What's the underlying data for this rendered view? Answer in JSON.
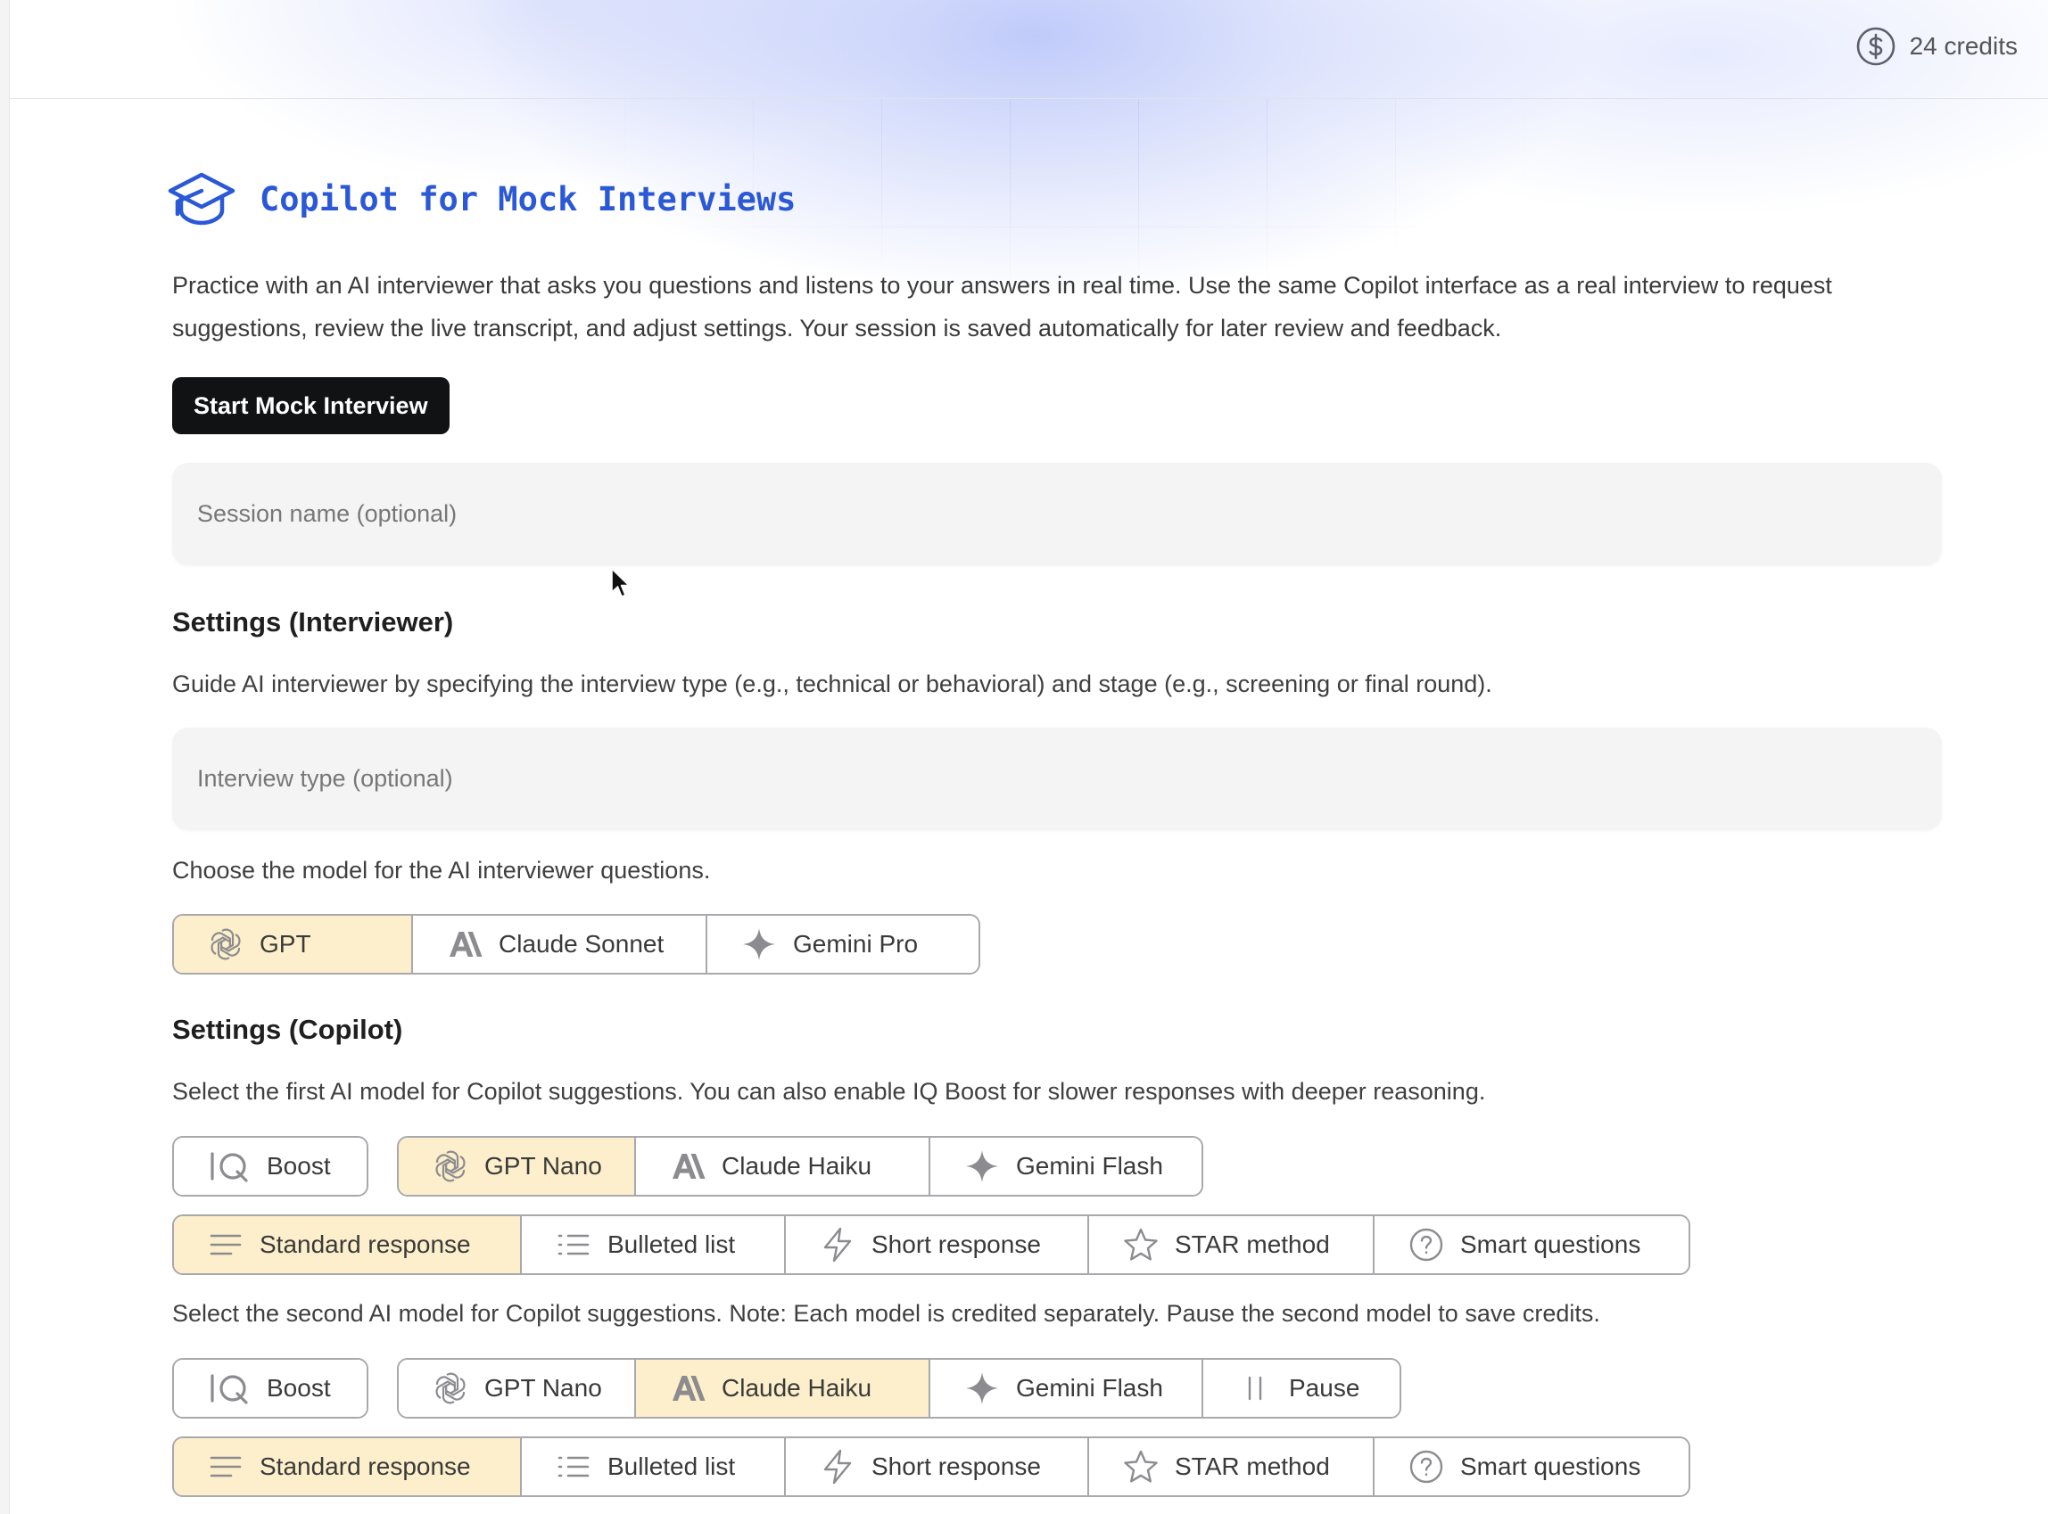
{
  "header": {
    "credits_label": "24 credits"
  },
  "page": {
    "title": "Copilot for Mock Interviews",
    "intro": "Practice with an AI interviewer that asks you questions and listens to your answers in real time. Use the same Copilot interface as a real interview to request suggestions, review the live transcript, and adjust settings. Your session is saved automatically for later review and feedback.",
    "start_button": "Start Mock Interview",
    "session_placeholder": "Session name (optional)"
  },
  "interviewer": {
    "heading": "Settings (Interviewer)",
    "desc": "Guide AI interviewer by specifying the interview type (e.g., technical or behavioral) and stage (e.g., screening or final round).",
    "type_placeholder": "Interview type (optional)",
    "model_desc": "Choose the model for the AI interviewer questions.",
    "models": [
      {
        "label": "GPT",
        "icon": "openai-icon",
        "selected": true
      },
      {
        "label": "Claude Sonnet",
        "icon": "anthropic-icon",
        "selected": false
      },
      {
        "label": "Gemini Pro",
        "icon": "gemini-icon",
        "selected": false
      }
    ]
  },
  "copilot": {
    "heading": "Settings (Copilot)",
    "first_desc": "Select the first AI model for Copilot suggestions. You can also enable IQ Boost for slower responses with deeper reasoning.",
    "second_desc": "Select the second AI model for Copilot suggestions. Note: Each model is credited separately. Pause the second model to save credits.",
    "boost_label": "Boost",
    "first_models": [
      {
        "label": "GPT Nano",
        "icon": "openai-icon",
        "selected": true
      },
      {
        "label": "Claude Haiku",
        "icon": "anthropic-icon",
        "selected": false
      },
      {
        "label": "Gemini Flash",
        "icon": "gemini-icon",
        "selected": false
      }
    ],
    "second_models": [
      {
        "label": "GPT Nano",
        "icon": "openai-icon",
        "selected": false
      },
      {
        "label": "Claude Haiku",
        "icon": "anthropic-icon",
        "selected": true
      },
      {
        "label": "Gemini Flash",
        "icon": "gemini-icon",
        "selected": false
      },
      {
        "label": "Pause",
        "icon": "pause-icon",
        "selected": false
      }
    ],
    "first_styles": [
      {
        "label": "Standard response",
        "icon": "standard-lines-icon",
        "selected": true
      },
      {
        "label": "Bulleted list",
        "icon": "bulleted-list-icon",
        "selected": false
      },
      {
        "label": "Short response",
        "icon": "lightning-icon",
        "selected": false
      },
      {
        "label": "STAR method",
        "icon": "star-icon",
        "selected": false
      },
      {
        "label": "Smart questions",
        "icon": "question-circle-icon",
        "selected": false
      }
    ],
    "second_styles": [
      {
        "label": "Standard response",
        "icon": "standard-lines-icon",
        "selected": true
      },
      {
        "label": "Bulleted list",
        "icon": "bulleted-list-icon",
        "selected": false
      },
      {
        "label": "Short response",
        "icon": "lightning-icon",
        "selected": false
      },
      {
        "label": "STAR method",
        "icon": "star-icon",
        "selected": false
      },
      {
        "label": "Smart questions",
        "icon": "question-circle-icon",
        "selected": false
      }
    ]
  },
  "colors": {
    "accent": "#2b58d6",
    "selected_bg": "#fdefcb",
    "primary_button": "#111214"
  }
}
